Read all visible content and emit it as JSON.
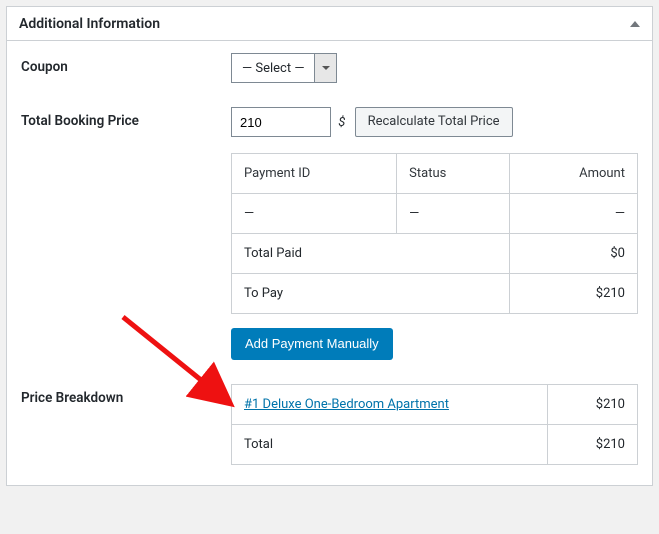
{
  "panel": {
    "title": "Additional Information"
  },
  "coupon": {
    "label": "Coupon",
    "select_display": "— Select —"
  },
  "total_price": {
    "label": "Total Booking Price",
    "value": "210",
    "currency": "$",
    "recalc_label": "Recalculate Total Price"
  },
  "payments": {
    "headers": {
      "id": "Payment ID",
      "status": "Status",
      "amount": "Amount"
    },
    "rows": [
      {
        "id": "—",
        "status": "—",
        "amount": "—"
      }
    ],
    "total_paid_label": "Total Paid",
    "total_paid_value": "$0",
    "to_pay_label": "To Pay",
    "to_pay_value": "$210",
    "add_manual_label": "Add Payment Manually"
  },
  "breakdown": {
    "label": "Price Breakdown",
    "items": [
      {
        "name": "#1 Deluxe One-Bedroom Apartment",
        "amount": "$210"
      }
    ],
    "total_label": "Total",
    "total_value": "$210"
  }
}
